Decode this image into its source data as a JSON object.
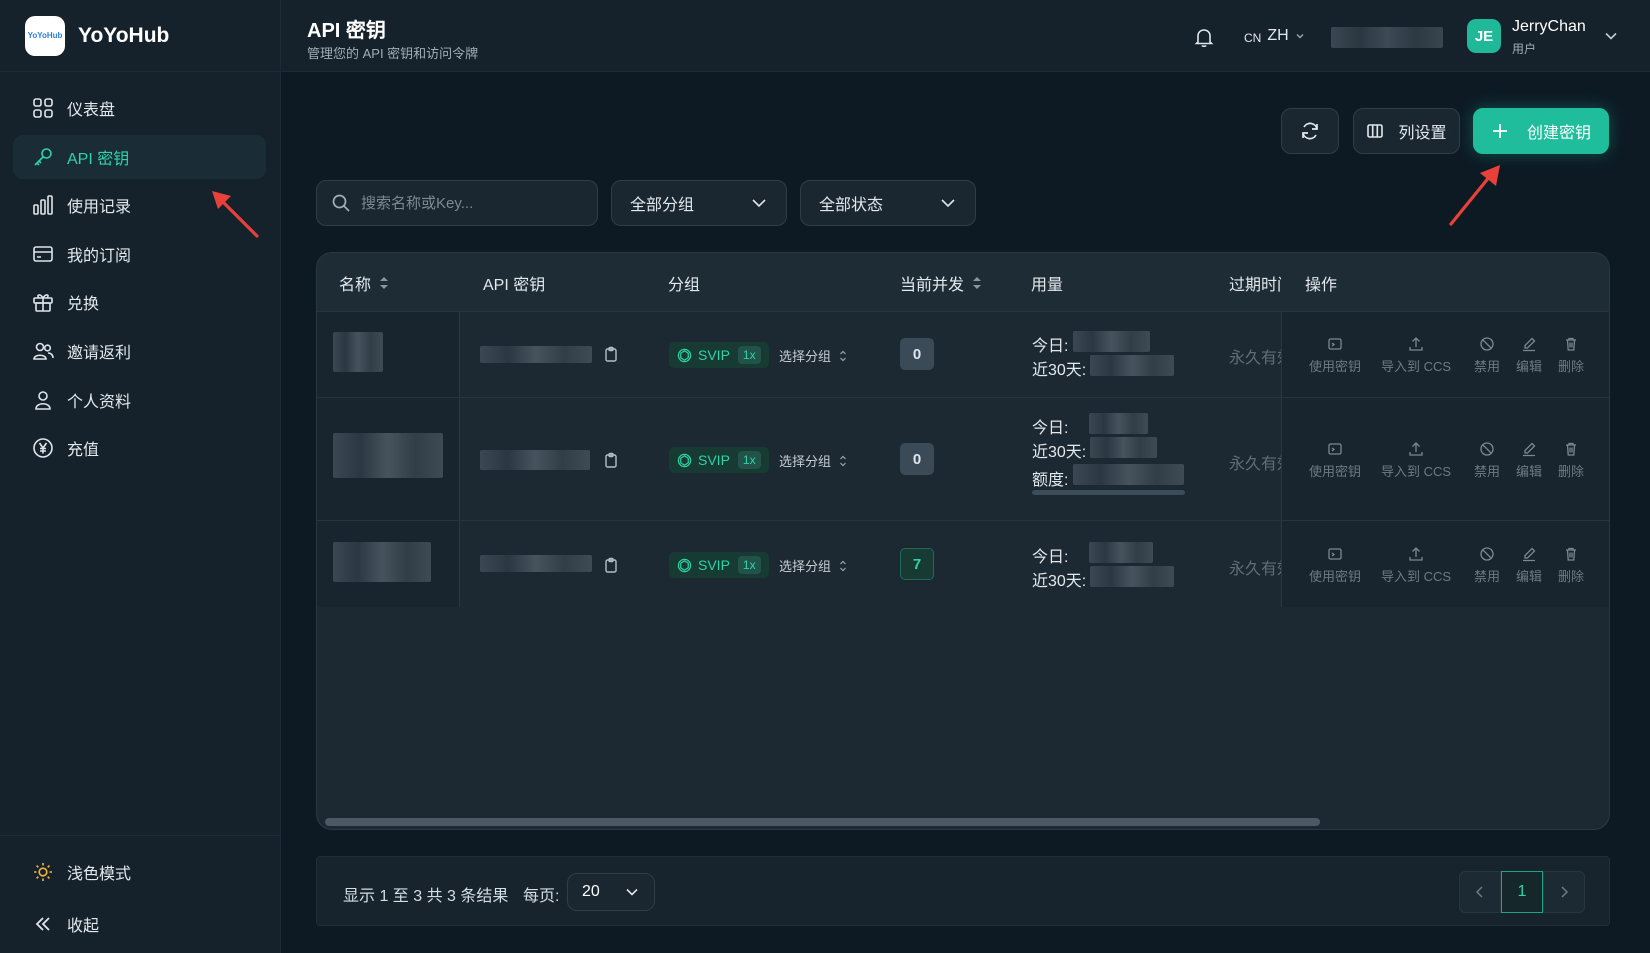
{
  "brand": {
    "logo_text": "YoYoHub",
    "name": "YoYoHub"
  },
  "sidebar": {
    "items": [
      {
        "label": "仪表盘",
        "icon": "dashboard-icon"
      },
      {
        "label": "API 密钥",
        "icon": "key-icon",
        "active": true
      },
      {
        "label": "使用记录",
        "icon": "bar-chart-icon"
      },
      {
        "label": "我的订阅",
        "icon": "card-icon"
      },
      {
        "label": "兑换",
        "icon": "gift-icon"
      },
      {
        "label": "邀请返利",
        "icon": "users-icon"
      },
      {
        "label": "个人资料",
        "icon": "user-icon"
      },
      {
        "label": "充值",
        "icon": "yen-icon"
      }
    ],
    "theme_label": "浅色模式",
    "collapse_label": "收起"
  },
  "header": {
    "title": "API 密钥",
    "subtitle": "管理您的 API 密钥和访问令牌",
    "lang_flag": "CN",
    "lang": "ZH",
    "user_initials": "JE",
    "user_name": "JerryChan",
    "user_role": "用户"
  },
  "toolbar": {
    "columns_label": "列设置",
    "create_label": "创建密钥"
  },
  "filters": {
    "search_placeholder": "搜索名称或Key...",
    "group": "全部分组",
    "status": "全部状态"
  },
  "table": {
    "columns": [
      "名称",
      "API 密钥",
      "分组",
      "当前并发",
      "用量",
      "过期时间",
      "操作"
    ],
    "rows": [
      {
        "group": "SVIP",
        "multiplier": "1x",
        "group_pick": "选择分组",
        "concurrency": "0",
        "usage_labels": [
          "今日:",
          "近30天:"
        ],
        "expiry": "永久有效"
      },
      {
        "group": "SVIP",
        "multiplier": "1x",
        "group_pick": "选择分组",
        "concurrency": "0",
        "usage_labels": [
          "今日:",
          "近30天:",
          "额度:"
        ],
        "expiry": "永久有效"
      },
      {
        "group": "SVIP",
        "multiplier": "1x",
        "group_pick": "选择分组",
        "concurrency": "7",
        "usage_labels": [
          "今日:",
          "近30天:"
        ],
        "expiry": "永久有效"
      }
    ],
    "actions": [
      "使用密钥",
      "导入到 CCS",
      "禁用",
      "编辑",
      "删除"
    ]
  },
  "pagination": {
    "info": "显示 1 至 3 共 3 条结果",
    "per_page_label": "每页:",
    "per_page": "20",
    "current_page": "1"
  },
  "colors": {
    "accent": "#1fbd9c",
    "background": "#0d1a24",
    "sidebar": "#15222c",
    "annotation_arrow": "#e8413a"
  }
}
